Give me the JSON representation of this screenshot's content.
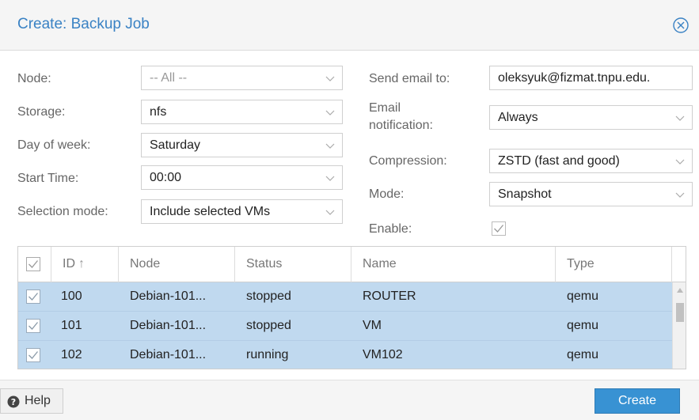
{
  "window": {
    "title": "Create: Backup Job"
  },
  "form": {
    "node": {
      "label": "Node:",
      "value": "-- All --"
    },
    "storage": {
      "label": "Storage:",
      "value": "nfs"
    },
    "day_of_week": {
      "label": "Day of week:",
      "value": "Saturday"
    },
    "start_time": {
      "label": "Start Time:",
      "value": "00:00"
    },
    "selection_mode": {
      "label": "Selection mode:",
      "value": "Include selected VMs"
    },
    "send_email": {
      "label": "Send email to:",
      "value": "oleksyuk@fizmat.tnpu.edu."
    },
    "email_notification": {
      "label_line1": "Email",
      "label_line2": "notification:",
      "value": "Always"
    },
    "compression": {
      "label": "Compression:",
      "value": "ZSTD (fast and good)"
    },
    "mode": {
      "label": "Mode:",
      "value": "Snapshot"
    },
    "enable": {
      "label": "Enable:",
      "checked": true
    }
  },
  "grid": {
    "columns": [
      "ID",
      "Node",
      "Status",
      "Name",
      "Type"
    ],
    "sort_indicator": "↑",
    "rows": [
      {
        "id": "100",
        "node": "Debian-101...",
        "status": "stopped",
        "name": "ROUTER",
        "type": "qemu",
        "checked": true
      },
      {
        "id": "101",
        "node": "Debian-101...",
        "status": "stopped",
        "name": "VM",
        "type": "qemu",
        "checked": true
      },
      {
        "id": "102",
        "node": "Debian-101...",
        "status": "running",
        "name": "VM102",
        "type": "qemu",
        "checked": true
      }
    ]
  },
  "footer": {
    "help_label": "Help",
    "create_label": "Create"
  },
  "colors": {
    "accent": "#3892d3",
    "title": "#3a82c4",
    "row_selected": "#c0d9ef"
  }
}
